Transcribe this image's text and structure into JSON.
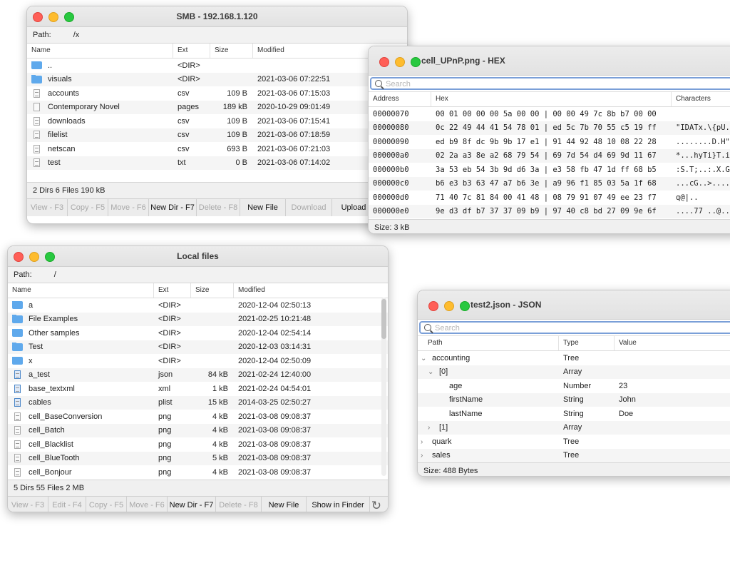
{
  "smb": {
    "title": "SMB - 192.168.1.120",
    "path_label": "Path:",
    "path_value": "/x",
    "columns": [
      "Name",
      "Ext",
      "Size",
      "Modified"
    ],
    "rows": [
      {
        "name": "..",
        "ext": "<DIR>",
        "size": "",
        "modified": "",
        "icon": "folder"
      },
      {
        "name": "visuals",
        "ext": "<DIR>",
        "size": "",
        "modified": "2021-03-06 07:22:51",
        "icon": "folder"
      },
      {
        "name": "accounts",
        "ext": "csv",
        "size": "109 B",
        "modified": "2021-03-06 07:15:03",
        "icon": "doc"
      },
      {
        "name": "Contemporary Novel",
        "ext": "pages",
        "size": "189 kB",
        "modified": "2020-10-29 09:01:49",
        "icon": "plain"
      },
      {
        "name": "downloads",
        "ext": "csv",
        "size": "109 B",
        "modified": "2021-03-06 07:15:41",
        "icon": "doc"
      },
      {
        "name": "filelist",
        "ext": "csv",
        "size": "109 B",
        "modified": "2021-03-06 07:18:59",
        "icon": "doc"
      },
      {
        "name": "netscan",
        "ext": "csv",
        "size": "693 B",
        "modified": "2021-03-06 07:21:03",
        "icon": "doc"
      },
      {
        "name": "test",
        "ext": "txt",
        "size": "0 B",
        "modified": "2021-03-06 07:14:02",
        "icon": "doc"
      }
    ],
    "status": "2 Dirs 6 Files 190 kB",
    "toolbar": [
      {
        "label": "View - F3",
        "enabled": false
      },
      {
        "label": "Copy - F5",
        "enabled": false
      },
      {
        "label": "Move - F6",
        "enabled": false
      },
      {
        "label": "New Dir - F7",
        "enabled": true
      },
      {
        "label": "Delete - F8",
        "enabled": false
      },
      {
        "label": "New File",
        "enabled": true
      },
      {
        "label": "Download",
        "enabled": false
      },
      {
        "label": "Upload",
        "enabled": true
      }
    ]
  },
  "hex": {
    "title": "cell_UPnP.png - HEX",
    "search_placeholder": "Search",
    "columns": [
      "Address",
      "Hex",
      "Characters"
    ],
    "rows": [
      {
        "address": "00000070",
        "hex": "00 01 00 00 00 5a 00 00 | 00 00 49 7c 8b b7 00 00",
        "chars": ""
      },
      {
        "address": "00000080",
        "hex": "0c 22 49 44 41 54 78 01 | ed 5c 7b 70 55 c5 19 ff",
        "chars": "\"IDATx.\\{pU."
      },
      {
        "address": "00000090",
        "hex": "ed b9 8f dc 9b 9b 17 e1 | 91 44 92 48 10 08 22 28",
        "chars": "........D.H\""
      },
      {
        "address": "000000a0",
        "hex": "02 2a a3 8e a2 68 79 54 | 69 7d 54 d4 69 9d 11 67",
        "chars": "*...hyTi}T.i"
      },
      {
        "address": "000000b0",
        "hex": "3a 53 eb 54 3b 9d d6 3a | e3 58 fb 47 1d ff 68 b5",
        "chars": ":S.T;..:.X.G"
      },
      {
        "address": "000000c0",
        "hex": "b6 e3 b3 63 47 a7 b6 3e | a9 96 f1 85 03 5a 1f 68",
        "chars": "...cG..>...."
      },
      {
        "address": "000000d0",
        "hex": "71 40 7c 81 84 00 41 48 | 08 79 91 07 49 ee 23 f7",
        "chars": "q@|.."
      },
      {
        "address": "000000e0",
        "hex": "9e d3 df b7 37 37 09 b9 | 97 40 c8 bd 27 09 9e 6f",
        "chars": "....77 ..@.."
      }
    ],
    "status": "Size: 3 kB"
  },
  "local": {
    "title": "Local files",
    "path_label": "Path:",
    "path_value": "/",
    "columns": [
      "Name",
      "Ext",
      "Size",
      "Modified"
    ],
    "rows": [
      {
        "name": "a",
        "ext": "<DIR>",
        "size": "",
        "modified": "2020-12-04 02:50:13",
        "icon": "folder"
      },
      {
        "name": "File Examples",
        "ext": "<DIR>",
        "size": "",
        "modified": "2021-02-25 10:21:48",
        "icon": "folder"
      },
      {
        "name": "Other samples",
        "ext": "<DIR>",
        "size": "",
        "modified": "2020-12-04 02:54:14",
        "icon": "folder"
      },
      {
        "name": "Test",
        "ext": "<DIR>",
        "size": "",
        "modified": "2020-12-03 03:14:31",
        "icon": "folder"
      },
      {
        "name": "x",
        "ext": "<DIR>",
        "size": "",
        "modified": "2020-12-04 02:50:09",
        "icon": "folder"
      },
      {
        "name": "a_test",
        "ext": "json",
        "size": "84 kB",
        "modified": "2021-02-24 12:40:00",
        "icon": "blue"
      },
      {
        "name": "base_textxml",
        "ext": "xml",
        "size": "1 kB",
        "modified": "2021-02-24 04:54:01",
        "icon": "blue"
      },
      {
        "name": "cables",
        "ext": "plist",
        "size": "15 kB",
        "modified": "2014-03-25 02:50:27",
        "icon": "blue"
      },
      {
        "name": "cell_BaseConversion",
        "ext": "png",
        "size": "4 kB",
        "modified": "2021-03-08 09:08:37",
        "icon": "doc"
      },
      {
        "name": "cell_Batch",
        "ext": "png",
        "size": "4 kB",
        "modified": "2021-03-08 09:08:37",
        "icon": "doc"
      },
      {
        "name": "cell_Blacklist",
        "ext": "png",
        "size": "4 kB",
        "modified": "2021-03-08 09:08:37",
        "icon": "doc"
      },
      {
        "name": "cell_BlueTooth",
        "ext": "png",
        "size": "5 kB",
        "modified": "2021-03-08 09:08:37",
        "icon": "doc"
      },
      {
        "name": "cell_Bonjour",
        "ext": "png",
        "size": "4 kB",
        "modified": "2021-03-08 09:08:37",
        "icon": "doc"
      }
    ],
    "status": "5 Dirs 55 Files 2 MB",
    "toolbar": [
      {
        "label": "View - F3",
        "enabled": false
      },
      {
        "label": "Edit - F4",
        "enabled": false
      },
      {
        "label": "Copy - F5",
        "enabled": false
      },
      {
        "label": "Move - F6",
        "enabled": false
      },
      {
        "label": "New Dir - F7",
        "enabled": true
      },
      {
        "label": "Delete - F8",
        "enabled": false
      },
      {
        "label": "New File",
        "enabled": true
      },
      {
        "label": "Show in Finder",
        "enabled": true
      }
    ]
  },
  "json": {
    "title": "test2.json - JSON",
    "search_placeholder": "Search",
    "columns": [
      "Path",
      "Type",
      "Value"
    ],
    "rows": [
      {
        "path": "accounting",
        "type": "Tree",
        "value": "",
        "level": 0,
        "chevron": "open"
      },
      {
        "path": "[0]",
        "type": "Array",
        "value": "",
        "level": 1,
        "chevron": "open"
      },
      {
        "path": "age",
        "type": "Number",
        "value": "23",
        "level": 2,
        "chevron": "none"
      },
      {
        "path": "firstName",
        "type": "String",
        "value": "John",
        "level": 2,
        "chevron": "none"
      },
      {
        "path": "lastName",
        "type": "String",
        "value": "Doe",
        "level": 2,
        "chevron": "none"
      },
      {
        "path": "[1]",
        "type": "Array",
        "value": "",
        "level": 1,
        "chevron": "closed"
      },
      {
        "path": "quark",
        "type": "Tree",
        "value": "",
        "level": 0,
        "chevron": "closed"
      },
      {
        "path": "sales",
        "type": "Tree",
        "value": "",
        "level": 0,
        "chevron": "closed"
      }
    ],
    "status": "Size: 488 Bytes"
  },
  "colors": {
    "folder": "#5fa9ec",
    "focus": "#7a9fd8",
    "close": "#ff5f57",
    "minimize": "#febc2e",
    "zoom": "#28c840"
  }
}
